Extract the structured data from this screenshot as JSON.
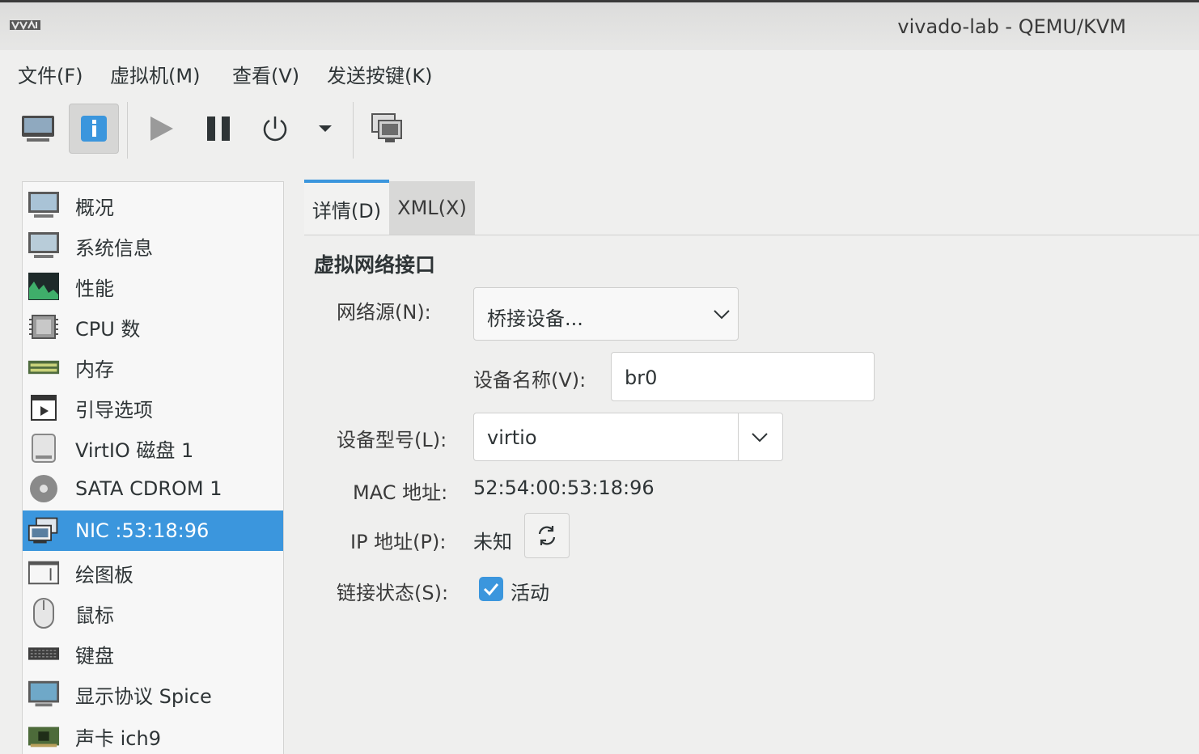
{
  "window": {
    "title": "vivado-lab - QEMU/KVM"
  },
  "menubar": {
    "items": [
      "文件(F)",
      "虚拟机(M)",
      "查看(V)",
      "发送按键(K)"
    ]
  },
  "toolbar": {
    "buttons": [
      "console-icon",
      "info-icon",
      "play-icon",
      "pause-icon",
      "power-icon",
      "dropdown-icon",
      "snapshot-icon"
    ]
  },
  "sidebar": {
    "items": [
      {
        "label": "概况",
        "icon": "monitor-icon"
      },
      {
        "label": "系统信息",
        "icon": "monitor-icon"
      },
      {
        "label": "性能",
        "icon": "performance-icon"
      },
      {
        "label": "CPU 数",
        "icon": "cpu-icon"
      },
      {
        "label": "内存",
        "icon": "memory-icon"
      },
      {
        "label": "引导选项",
        "icon": "boot-icon"
      },
      {
        "label": "VirtIO 磁盘 1",
        "icon": "disk-icon"
      },
      {
        "label": "SATA CDROM 1",
        "icon": "cdrom-icon"
      },
      {
        "label": "NIC :53:18:96",
        "icon": "nic-icon"
      },
      {
        "label": "绘图板",
        "icon": "tablet-icon"
      },
      {
        "label": "鼠标",
        "icon": "mouse-icon"
      },
      {
        "label": "键盘",
        "icon": "keyboard-icon"
      },
      {
        "label": "显示协议 Spice",
        "icon": "display-icon"
      },
      {
        "label": "声卡 ich9",
        "icon": "sound-icon"
      }
    ],
    "selected_index": 8
  },
  "tabs": {
    "details": "详情(D)",
    "xml": "XML(X)"
  },
  "details": {
    "section_title": "虚拟网络接口",
    "network_source_label": "网络源(N):",
    "network_source_value": "桥接设备...",
    "device_name_label": "设备名称(V):",
    "device_name_value": "br0",
    "device_model_label": "设备型号(L):",
    "device_model_value": "virtio",
    "mac_label": "MAC 地址:",
    "mac_value": "52:54:00:53:18:96",
    "ip_label": "IP 地址(P):",
    "ip_value": "未知",
    "link_state_label": "链接状态(S):",
    "link_state_value": "活动",
    "link_state_checked": true
  },
  "colors": {
    "accent": "#3b96dd"
  }
}
